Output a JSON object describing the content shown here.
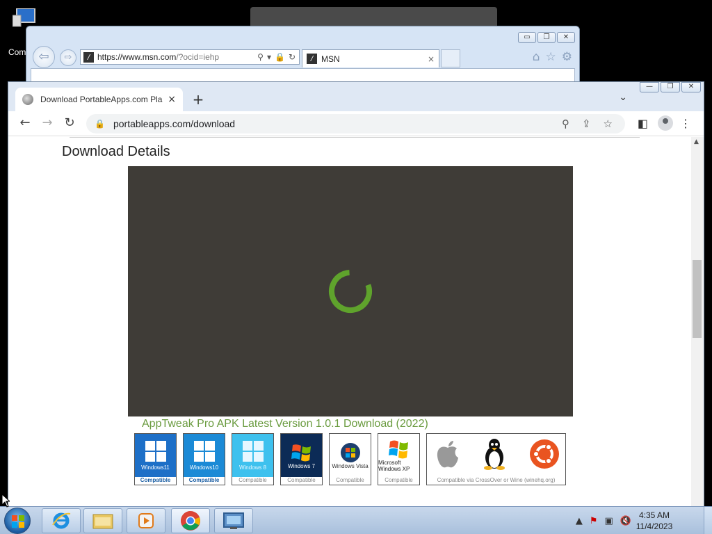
{
  "desktop": {
    "icon_label": "Com"
  },
  "ie": {
    "address_url_main": "https://www.msn.com",
    "address_url_rest": "/?ocid=iehp",
    "tab_title": "MSN",
    "tab_close": "×",
    "min": "▭",
    "restore": "❐",
    "close": "✕"
  },
  "chrome": {
    "tab_title": "Download PortableApps.com Pla",
    "tab_close": "×",
    "new_tab": "+",
    "address": "portableapps.com/download",
    "min": "—",
    "restore": "❐",
    "close": "✕"
  },
  "page": {
    "title": "Download Details",
    "app_caption": "AppTweak Pro APK Latest Version 1.0.1 Download (2022)",
    "badges": [
      {
        "name": "Windows11",
        "foot": "Compatible"
      },
      {
        "name": "Windows10",
        "foot": "Compatible"
      },
      {
        "name": "Windows 8",
        "foot": "Compatible"
      },
      {
        "name": "Windows 7",
        "foot": "Compatible"
      },
      {
        "name": "Windows Vista",
        "foot": "Compatible"
      },
      {
        "name": "Microsoft Windows XP",
        "foot": "Compatible"
      }
    ],
    "wide_badge_foot": "Compatible via CrossOver or Wine (winehq.org)"
  },
  "taskbar": {
    "time": "4:35 AM",
    "date": "11/4/2023"
  }
}
